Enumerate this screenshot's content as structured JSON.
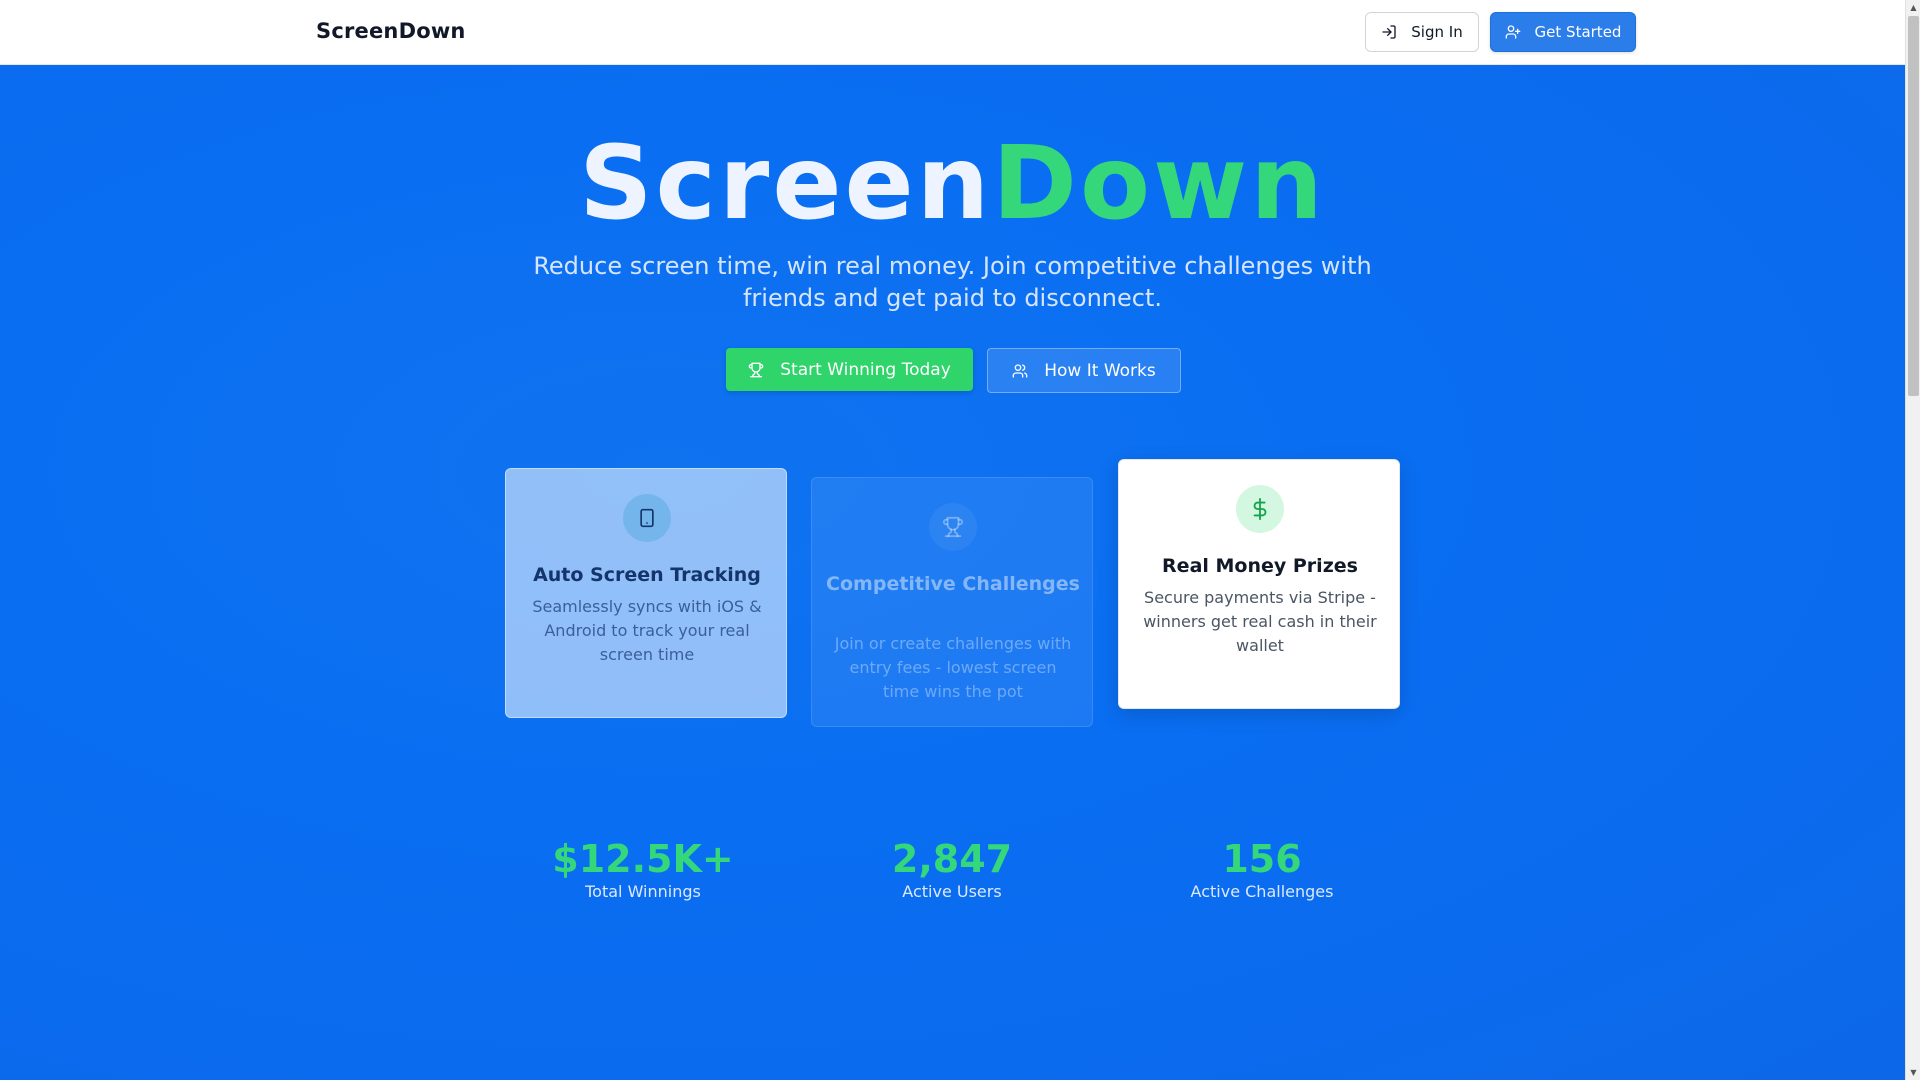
{
  "header": {
    "brand": "ScreenDown",
    "sign_in_label": "Sign In",
    "get_started_label": "Get Started"
  },
  "hero": {
    "title_part1": "Screen",
    "title_part2": "Down",
    "subtitle": "Reduce screen time, win real money. Join competitive challenges with friends and get paid to disconnect.",
    "primary_cta": "Start Winning Today",
    "secondary_cta": "How It Works"
  },
  "features": [
    {
      "icon": "smartphone-icon",
      "title": "Auto Screen Tracking",
      "description": "Seamlessly syncs with iOS & Android to track your real screen time"
    },
    {
      "icon": "trophy-icon",
      "title": "Competitive Challenges",
      "description": "Join or create challenges with entry fees - lowest screen time wins the pot"
    },
    {
      "icon": "dollar-icon",
      "title": "Real Money Prizes",
      "description": "Secure payments via Stripe - winners get real cash in their wallet"
    }
  ],
  "stats": [
    {
      "value": "$12.5K+",
      "label": "Total Winnings"
    },
    {
      "value": "2,847",
      "label": "Active Users"
    },
    {
      "value": "156",
      "label": "Active Challenges"
    }
  ],
  "colors": {
    "brand_blue": "#0b6ef0",
    "accent_green": "#34d87a",
    "button_blue": "#2b7de9"
  }
}
